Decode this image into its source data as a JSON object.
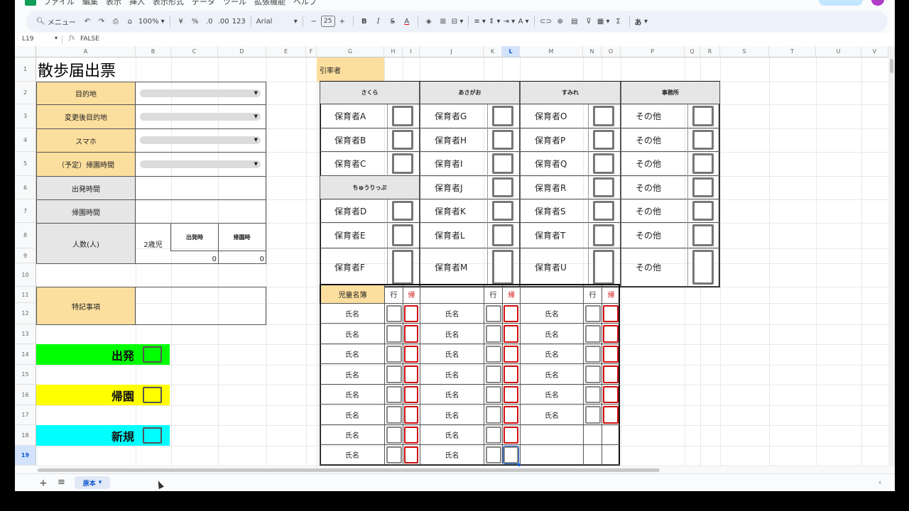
{
  "menu": {
    "items": [
      "ファイル",
      "編集",
      "表示",
      "挿入",
      "表示形式",
      "データ",
      "ツール",
      "拡張機能",
      "ヘルプ"
    ]
  },
  "toolbar": {
    "search": "メニュー",
    "zoom": "100%",
    "currency": "¥",
    "percent": "%",
    "decrease_decimal": ".0",
    "increase_decimal": ".00",
    "number_format": "123",
    "font": "Arial",
    "font_size": "25",
    "minus": "−",
    "plus": "+",
    "bold": "B",
    "italic": "I",
    "strike": "S",
    "text_color": "A",
    "sigma": "Σ",
    "input_mode": "あ"
  },
  "formula_bar": {
    "cell_ref": "L19",
    "fx": "fx",
    "value": "FALSE"
  },
  "columns": [
    "A",
    "B",
    "C",
    "D",
    "E",
    "F",
    "G",
    "H",
    "I",
    "J",
    "K",
    "L",
    "M",
    "N",
    "O",
    "P",
    "Q",
    "R",
    "S",
    "T",
    "U",
    "V"
  ],
  "rows": [
    "1",
    "2",
    "3",
    "4",
    "5",
    "6",
    "7",
    "8",
    "9",
    "10",
    "11",
    "12",
    "13",
    "14",
    "15",
    "16",
    "17",
    "18",
    "19"
  ],
  "form": {
    "title": "散歩届出票",
    "destination": "目的地",
    "changed_destination": "変更後目的地",
    "phone": "スマホ",
    "planned_return": "（予定）帰園時間",
    "departure_time": "出発時間",
    "return_time": "帰園時間",
    "headcount": "人数(人)",
    "age_group": "2歳児",
    "dep_col": "出発時",
    "ret_col": "帰園時",
    "dep_count": "0",
    "ret_count": "0",
    "notes": "特記事項"
  },
  "buttons": {
    "depart": "出発",
    "return": "帰園",
    "new": "新規"
  },
  "colors": {
    "depart": "#00ff00",
    "return": "#ffff00",
    "new": "#00ffff",
    "header": "#fcdf9e",
    "sheet_bg": "#f9fbfd"
  },
  "leaders": {
    "label": "引率者",
    "groups": [
      "さくら",
      "あさがお",
      "すみれ",
      "事務所"
    ],
    "sub_group": "ちゅうりっぷ",
    "col1": [
      "保育者A",
      "保育者B",
      "保育者C",
      "保育者D",
      "保育者E",
      "保育者F"
    ],
    "col2": [
      "保育者G",
      "保育者H",
      "保育者I",
      "保育者J",
      "保育者K",
      "保育者L",
      "保育者M"
    ],
    "col3": [
      "保育者O",
      "保育者P",
      "保育者Q",
      "保育者R",
      "保育者S",
      "保育者T",
      "保育者U"
    ],
    "col4": [
      "その他",
      "その他",
      "その他",
      "その他",
      "その他",
      "その他",
      "その他"
    ]
  },
  "roster": {
    "title": "児童名簿",
    "go": "行",
    "back": "帰",
    "name": "氏名"
  },
  "sheet_tab": {
    "name": "原本"
  }
}
